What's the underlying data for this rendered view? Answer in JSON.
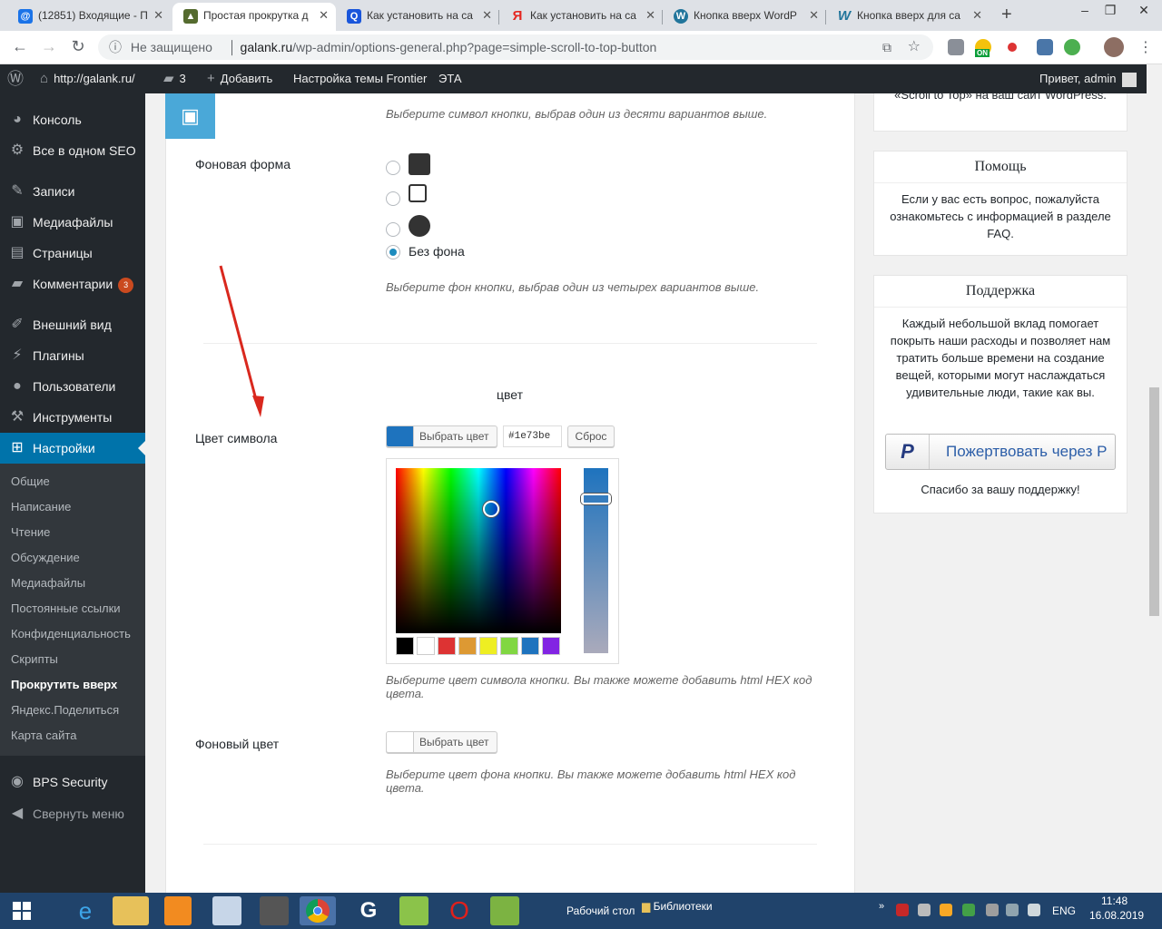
{
  "browser": {
    "tabs": [
      {
        "title": "(12851) Входящие - П",
        "icon": "mail-at-icon",
        "color": "#1a73e8",
        "glyph": "@"
      },
      {
        "title": "Простая прокрутка д",
        "icon": "plugin-favicon",
        "color": "#556b2f",
        "glyph": "▲",
        "active": true
      },
      {
        "title": "Как установить на са",
        "icon": "search-q-icon",
        "color": "#1a56db",
        "glyph": "Q"
      },
      {
        "title": "Как установить на са",
        "icon": "yandex-icon",
        "color": "#e52620",
        "glyph": "Я"
      },
      {
        "title": "Кнопка вверх WordP",
        "icon": "wordpress-icon",
        "color": "#21759b",
        "glyph": "W"
      },
      {
        "title": "Кнопка вверх для са",
        "icon": "wiki-w-icon",
        "color": "#21759b",
        "glyph": "W"
      }
    ],
    "insecure_label": "Не защищено",
    "url_host": "galank.ru",
    "url_path": "/wp-admin/options-general.php?page=simple-scroll-to-top-button",
    "ext_badge": "ON"
  },
  "adminbar": {
    "site": "http://galank.ru/",
    "comments": "3",
    "add": "Добавить",
    "theme": "Настройка темы Frontier",
    "eta": "ЭТА",
    "greeting": "Привет, admin"
  },
  "sidebar": {
    "items": [
      {
        "label": "Консоль",
        "icon": "dashboard-icon"
      },
      {
        "label": "Все в одном SEO",
        "icon": "gear-icon"
      },
      {
        "label": "Записи",
        "icon": "pin-icon"
      },
      {
        "label": "Медиафайлы",
        "icon": "media-icon"
      },
      {
        "label": "Страницы",
        "icon": "page-icon"
      },
      {
        "label": "Комментарии",
        "icon": "comment-icon",
        "badge": "3"
      },
      {
        "label": "Внешний вид",
        "icon": "brush-icon"
      },
      {
        "label": "Плагины",
        "icon": "plugin-icon"
      },
      {
        "label": "Пользователи",
        "icon": "user-icon"
      },
      {
        "label": "Инструменты",
        "icon": "wrench-icon"
      },
      {
        "label": "Настройки",
        "icon": "settings-icon"
      }
    ],
    "submenu": [
      "Общие",
      "Написание",
      "Чтение",
      "Обсуждение",
      "Медиафайлы",
      "Постоянные ссылки",
      "Конфиденциальность",
      "Скрипты",
      "Прокрутить вверх",
      "Яндекс.Поделиться",
      "Карта сайта"
    ],
    "bps": "BPS Security",
    "collapse": "Свернуть меню"
  },
  "main": {
    "symbol_desc": "Выберите символ кнопки, выбрав один из десяти вариантов выше.",
    "bg_shape_label": "Фоновая форма",
    "no_bg_label": "Без фона",
    "bg_shape_desc": "Выберите фон кнопки, выбрав один из четырех вариантов выше.",
    "section_title": "цвет",
    "symbol_color_label": "Цвет символа",
    "choose_color": "Выбрать цвет",
    "hex_value": "#1e73be",
    "reset": "Сброс",
    "palette": [
      "#000000",
      "#ffffff",
      "#dd3333",
      "#dd9933",
      "#eeee22",
      "#81d742",
      "#1e73be",
      "#8224e3"
    ],
    "symbol_color_desc": "Выберите цвет символа кнопки. Вы также можете добавить html HEX код цвета.",
    "bg_color_label": "Фоновый цвет",
    "bg_color_desc": "Выберите цвет фона кнопки. Вы также можете добавить html HEX код цвета."
  },
  "right": {
    "top_text": "«Scroll to Top» на ваш сайт WordPress.",
    "help_title": "Помощь",
    "help_text": "Если у вас есть вопрос, пожалуйста ознакомьтесь с информацией в разделе FAQ.",
    "support_title": "Поддержка",
    "support_text": "Каждый небольшой вклад помогает покрыть наши расходы и позволяет нам тратить больше времени на создание вещей, которыми могут наслаждаться удивительные люди, такие как вы.",
    "donate": "Пожертвовать через P",
    "thanks": "Спасибо за вашу поддержку!"
  },
  "taskbar": {
    "desktop": "Рабочий стол",
    "libraries": "Библиотеки",
    "lang": "ENG",
    "time": "11:48",
    "date": "16.08.2019"
  }
}
